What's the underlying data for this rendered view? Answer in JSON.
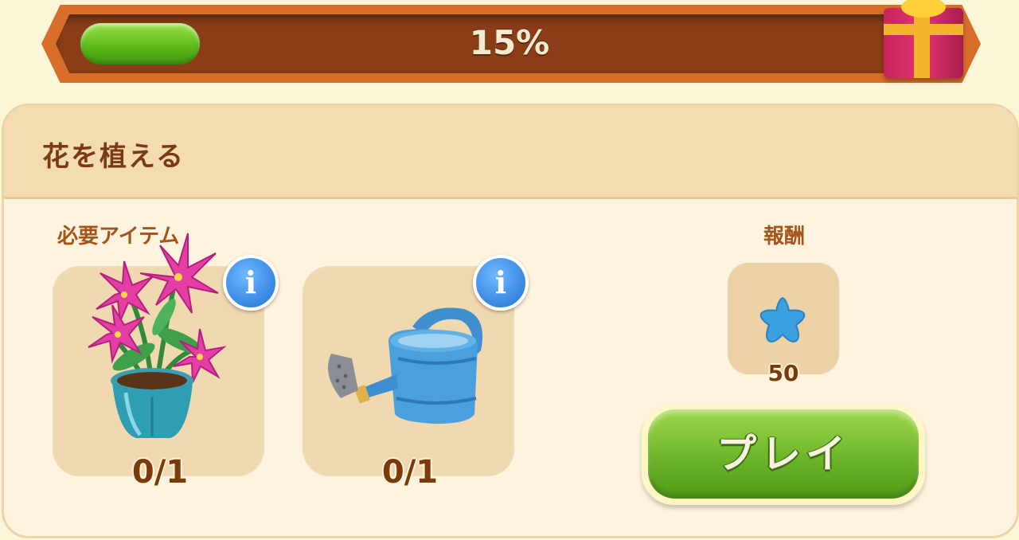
{
  "progress": {
    "percent_label": "15%",
    "fill_fraction": 0.15,
    "fill_color": "#58b818"
  },
  "gift": {
    "icon": "gift-box-icon"
  },
  "task": {
    "title": "花を植える",
    "required_label": "必要アイテム",
    "reward_label": "報酬"
  },
  "items": [
    {
      "icon": "potted-lily-icon",
      "count": "0/1"
    },
    {
      "icon": "watering-can-icon",
      "count": "0/1"
    }
  ],
  "info_icon": "i",
  "reward": {
    "icon": "blue-star-icon",
    "amount": "50"
  },
  "play_button": {
    "label": "プレイ",
    "color": "#6db52a"
  }
}
